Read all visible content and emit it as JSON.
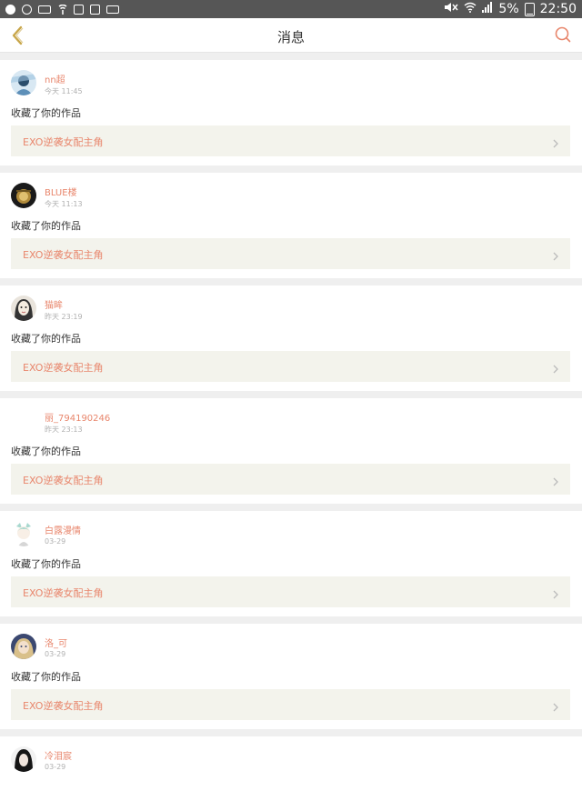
{
  "status_bar": {
    "battery": "5%",
    "time": "22:50",
    "icons": [
      "app-icon",
      "sync-icon",
      "signal-box-icon",
      "nfc-icon",
      "gallery-icon",
      "file-icon",
      "notification-icon",
      "mute-icon",
      "wifi-icon",
      "cell-signal-icon",
      "battery-icon"
    ]
  },
  "header": {
    "title": "消息",
    "back_icon": "chevron-left-icon",
    "search_icon": "search-icon"
  },
  "colors": {
    "accent": "#e8866c",
    "back": "#c8a64a",
    "card_bg": "#f3f3ec"
  },
  "messages": [
    {
      "user": "nn超",
      "time": "今天 11:45",
      "action": "收藏了你的作品",
      "work": "EXO逆袭女配主角"
    },
    {
      "user": "BLUE楼",
      "time": "今天 11:13",
      "action": "收藏了你的作品",
      "work": "EXO逆袭女配主角"
    },
    {
      "user": "猫眸",
      "time": "昨天 23:19",
      "action": "收藏了你的作品",
      "work": "EXO逆袭女配主角"
    },
    {
      "user": "丽_794190246",
      "time": "昨天 23:13",
      "action": "收藏了你的作品",
      "work": "EXO逆袭女配主角"
    },
    {
      "user": "白露漫情",
      "time": "03-29",
      "action": "收藏了你的作品",
      "work": "EXO逆袭女配主角"
    },
    {
      "user": "洛_可",
      "time": "03-29",
      "action": "收藏了你的作品",
      "work": "EXO逆袭女配主角"
    },
    {
      "user": "冷泪宸",
      "time": "03-29"
    }
  ]
}
